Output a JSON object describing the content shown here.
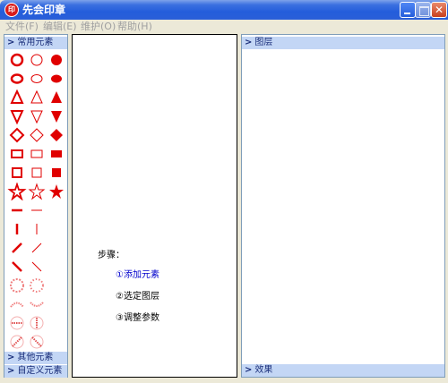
{
  "window": {
    "title": "先会印章",
    "app_icon_text": "印"
  },
  "menu": [
    {
      "label": "文件(F)"
    },
    {
      "label": "编辑(E)"
    },
    {
      "label": "维护(O)"
    },
    {
      "label": "帮助(H)"
    }
  ],
  "left_panel": {
    "sections": [
      {
        "label": "常用元素"
      },
      {
        "label": "其他元素"
      },
      {
        "label": "自定义元素"
      }
    ]
  },
  "canvas": {
    "steps_title": "步骤：",
    "steps": [
      {
        "label": "①添加元素",
        "color": "#0000cc"
      },
      {
        "label": "②选定图层",
        "color": "#000000"
      },
      {
        "label": "③调整参数",
        "color": "#000000"
      }
    ]
  },
  "right_panel": {
    "layers_label": "图层",
    "effects_label": "效果"
  },
  "colors": {
    "accent": "#e00000",
    "header_bg": "#c3d6f5",
    "header_text": "#1a2e7a"
  }
}
